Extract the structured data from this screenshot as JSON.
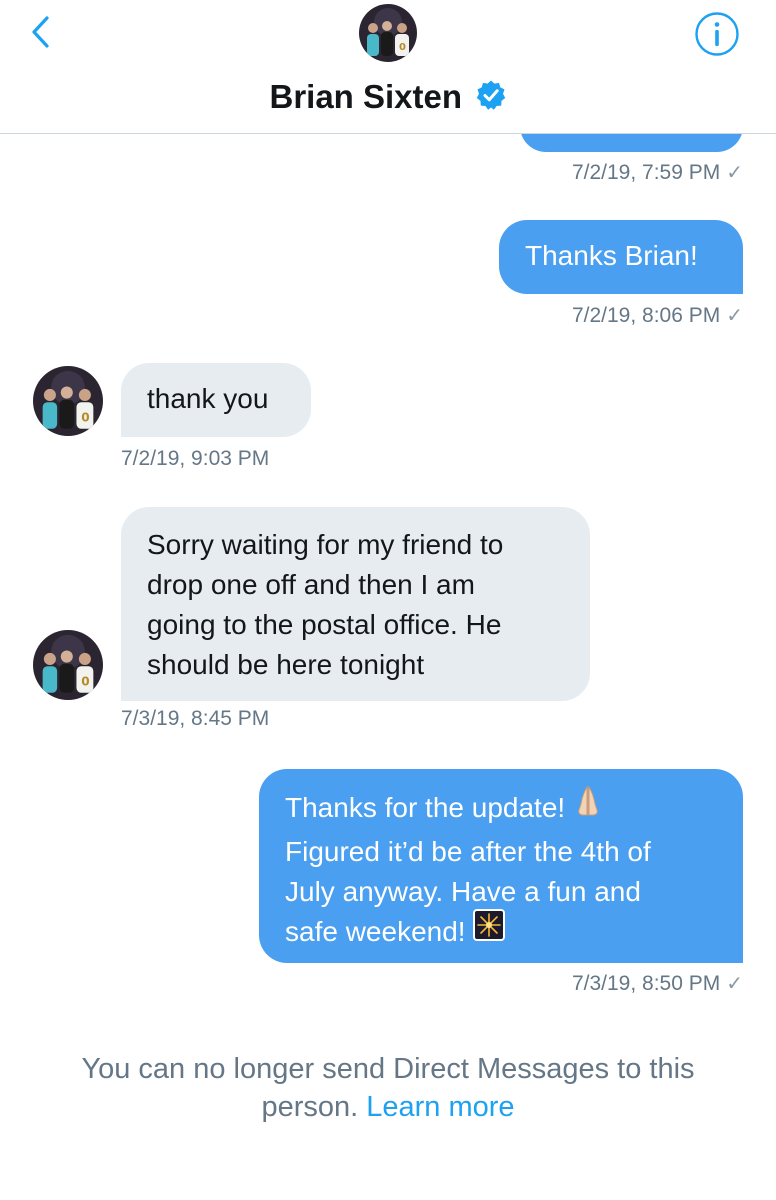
{
  "header": {
    "title": "Brian Sixten",
    "back_icon": "chevron-left-icon",
    "info_icon": "info-icon",
    "verified_icon": "verified-badge-icon"
  },
  "messages": [
    {
      "direction": "out",
      "text": "",
      "timestamp": "7/2/19, 7:59 PM",
      "status": "✓"
    },
    {
      "direction": "out",
      "text": "Thanks Brian!",
      "timestamp": "7/2/19, 8:06 PM",
      "status": "✓"
    },
    {
      "direction": "in",
      "text": "thank you",
      "timestamp": "7/2/19, 9:03 PM"
    },
    {
      "direction": "in",
      "lines": [
        "Sorry waiting for my friend to",
        "drop one off and then I am",
        "going to the postal office. He",
        "should be here tonight"
      ],
      "timestamp": "7/3/19, 8:45 PM"
    },
    {
      "direction": "out",
      "lines": [
        "Thanks for the update!",
        "Figured it’d be after the 4th of",
        "July anyway. Have a fun and",
        "safe weekend!"
      ],
      "emojis": [
        "folded-hands-emoji",
        "fireworks-emoji"
      ],
      "timestamp": "7/3/19, 8:50 PM",
      "status": "✓"
    }
  ],
  "footer": {
    "text": "You can no longer send Direct Messages to this",
    "text2": "person.",
    "link": "Learn more"
  },
  "colors": {
    "accent": "#1da1f2",
    "outgoing_bubble": "#4a9ff0",
    "incoming_bubble": "#e6ecf0",
    "muted_text": "#657786"
  }
}
